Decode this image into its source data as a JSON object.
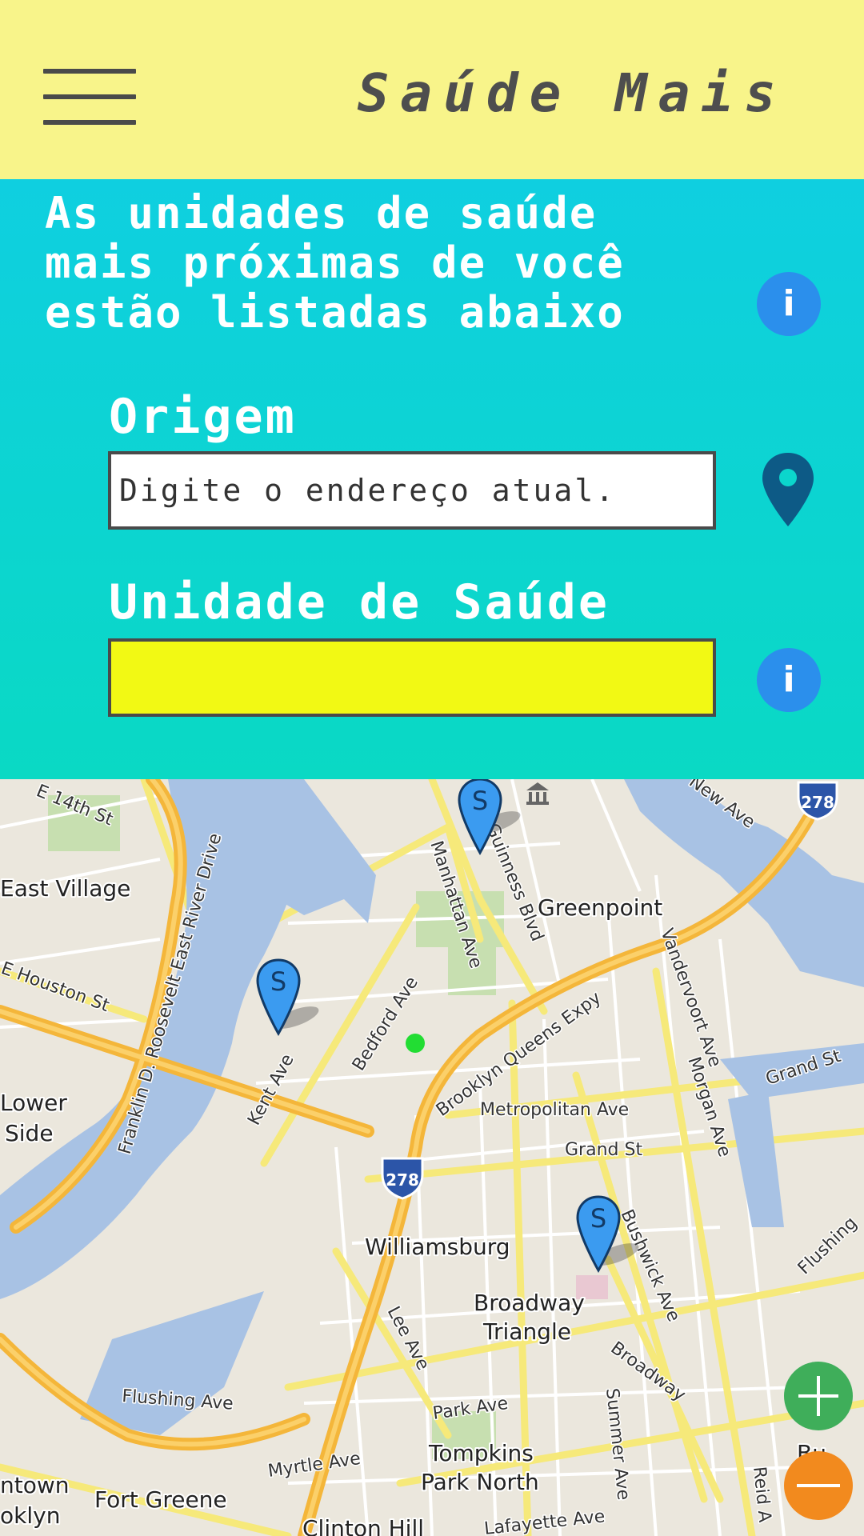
{
  "header": {
    "menu_icon": "hamburger-menu-icon",
    "title": "Saúde Mais",
    "background": "#f8f48a"
  },
  "panel": {
    "intro": "As unidades de saúde mais próximas de você estão listadas abaixo",
    "origin_label": "Origem",
    "origin_placeholder": "Digite o endereço atual.",
    "origin_value": "",
    "unit_label": "Unidade de Saúde",
    "unit_value": "",
    "info_icon_glyph": "i",
    "pin_icon": "map-pin-icon",
    "gradient": [
      "#0fcfe0",
      "#0ad9c4"
    ],
    "unit_field_color": "#f2f914"
  },
  "map": {
    "neighborhoods": [
      "East Village",
      "Greenpoint",
      "Williamsburg",
      "Broadway",
      "Triangle",
      "Tompkins",
      "Park North",
      "Fort Greene",
      "Lower",
      "Side",
      "Bushwick",
      "Clinton Hill"
    ],
    "streets": {
      "e_14th": "E 14th St",
      "e_houston": "E Houston St",
      "fdr_drive": "Franklin D. Roosevelt East River Drive",
      "kent": "Kent Ave",
      "bedford": "Bedford Ave",
      "manhattan": "Manhattan Ave",
      "guinness": "McGuinness Blvd",
      "bqe": "Brooklyn Queens Expy",
      "vandervoort": "Vandervoort Ave",
      "morgan": "Morgan Ave",
      "grand_st": "Grand St",
      "grand_st2": "Grand St",
      "metropolitan": "Metropolitan Ave",
      "lee": "Lee Ave",
      "bushwick_ave": "Bushwick Ave",
      "broadway": "Broadway",
      "summer": "Summer Ave",
      "park": "Park Ave",
      "flushing": "Flushing Ave",
      "flushing2": "Flushing",
      "myrtle": "Myrtle Ave",
      "lafayette": "Lafayette Ave",
      "reid": "Reid A",
      "new_ave": "New Ave",
      "town": "ntown",
      "klyn": "oklyn",
      "bu": "Bu"
    },
    "highway_shields": [
      "278",
      "278"
    ],
    "markers": [
      {
        "letter": "S"
      },
      {
        "letter": "S"
      },
      {
        "letter": "S"
      }
    ],
    "current_location_color": "#22dd33"
  },
  "zoom": {
    "in_icon": "plus-icon",
    "out_icon": "minus-icon",
    "in_color": "#3fae5a",
    "out_color": "#f28a1e"
  }
}
